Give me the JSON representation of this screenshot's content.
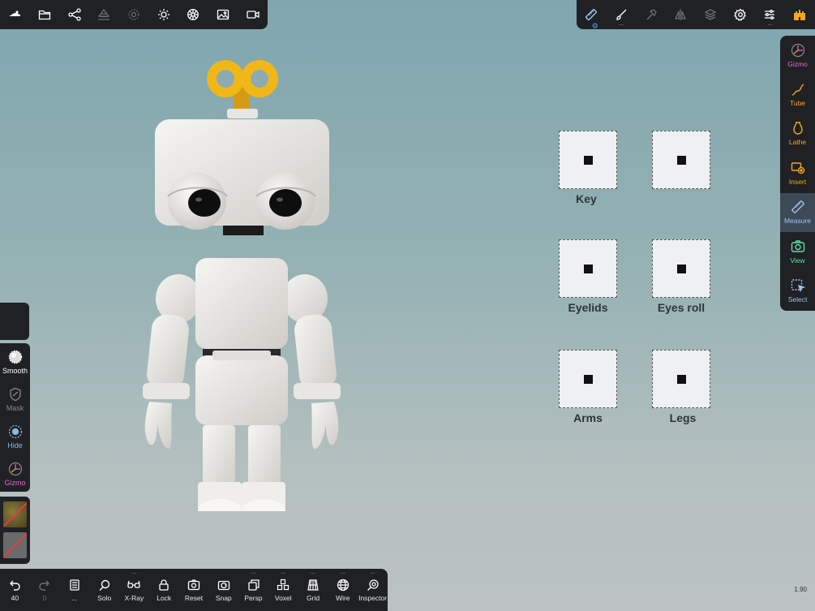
{
  "top_left_toolbar": {
    "icons": [
      "logo-icon",
      "folder-icon",
      "scene-graph-icon",
      "stack-icon",
      "target-icon",
      "sun-icon",
      "material-icon",
      "image-icon",
      "camera-icon"
    ]
  },
  "top_right_toolbar": {
    "icons": [
      "ruler-icon",
      "brush-icon",
      "hammer-icon",
      "symmetry-icon",
      "layers-icon",
      "settings-icon",
      "sliders-icon",
      "castle-icon"
    ],
    "ellipsis": "..."
  },
  "right_toolbar": {
    "items": [
      {
        "label": "Gizmo",
        "color": "#e06ad0",
        "active": false
      },
      {
        "label": "Tube",
        "color": "#f2a623",
        "active": false
      },
      {
        "label": "Lathe",
        "color": "#f2a623",
        "active": false
      },
      {
        "label": "Insert",
        "color": "#f2a623",
        "active": false
      },
      {
        "label": "Measure",
        "color": "#8fb7e0",
        "active": true
      },
      {
        "label": "View",
        "color": "#5ee0a4",
        "active": false
      },
      {
        "label": "Select",
        "color": "#8fb7e0",
        "active": false
      }
    ]
  },
  "left_toolbar": {
    "items": [
      {
        "label": "Smooth",
        "color": "#ffffff"
      },
      {
        "label": "Mask",
        "color": "#8a8a8a"
      },
      {
        "label": "Hide",
        "color": "#8fb7e0"
      },
      {
        "label": "Gizmo",
        "color": "#e06ad0"
      }
    ]
  },
  "bottom_toolbar": {
    "undo_count": "40",
    "redo_count": "0",
    "items": [
      "Solo",
      "X-Ray",
      "Lock",
      "Reset",
      "Snap",
      "Persp",
      "Voxel",
      "Grid",
      "Wire",
      "Inspector"
    ],
    "dots": "..."
  },
  "zoom_level": "1.90",
  "shape_keys": [
    {
      "label": "Key"
    },
    {
      "label": ""
    },
    {
      "label": "Eyelids"
    },
    {
      "label": "Eyes roll"
    },
    {
      "label": "Arms"
    },
    {
      "label": "Legs"
    }
  ],
  "colors": {
    "toolbar_bg": "#1f2124",
    "active_bg": "#3c4a58",
    "robot_white": "#eceae6",
    "key_yellow": "#f1b719"
  }
}
